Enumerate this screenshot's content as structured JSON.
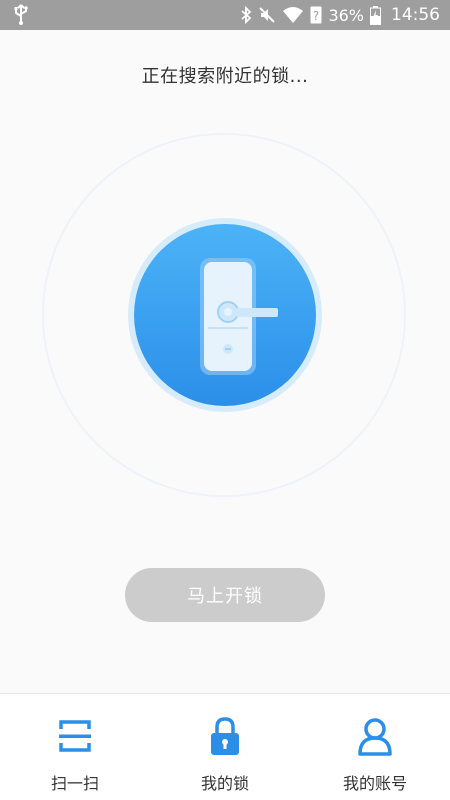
{
  "status_bar": {
    "battery_percent": "36%",
    "time": "14:56",
    "icons": [
      "usb-icon",
      "bluetooth-icon",
      "mute-icon",
      "wifi-icon",
      "sim-unknown-icon",
      "battery-icon"
    ]
  },
  "search": {
    "title": "正在搜索附近的锁..."
  },
  "actions": {
    "unlock_label": "马上开锁",
    "unlock_enabled": false
  },
  "bottom_nav": {
    "items": [
      {
        "label": "扫一扫",
        "icon": "scan-icon"
      },
      {
        "label": "我的锁",
        "icon": "padlock-icon"
      },
      {
        "label": "我的账号",
        "icon": "user-icon"
      }
    ]
  },
  "colors": {
    "accent": "#2b8fe9",
    "status_bar": "#9e9e9e",
    "button_disabled": "#cccccc"
  }
}
